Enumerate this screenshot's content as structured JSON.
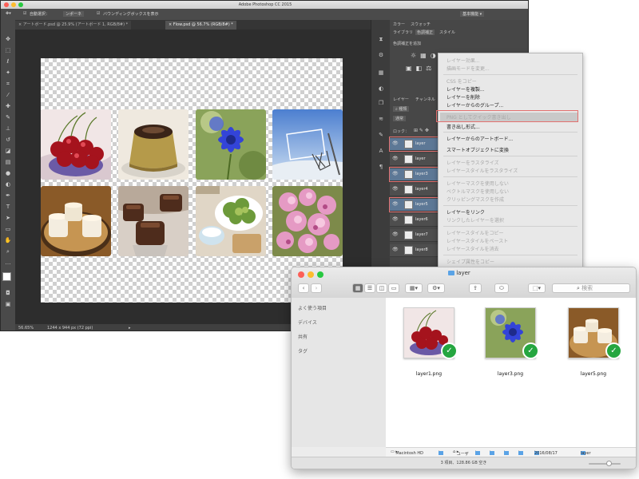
{
  "photoshop": {
    "title": "Adobe Photoshop CC 2015",
    "options": {
      "auto_select": "自動選択：",
      "auto_select_value": "ンポーネ",
      "transform_controls": "バウンディングボックスを表示"
    },
    "tabs": [
      {
        "label": "アートボード.psd @ 25.9% (アートボード 1, RGB/8#) *"
      },
      {
        "label": "Flow.psd @ 56.7% (RGB/8#) *"
      }
    ],
    "status": {
      "zoom": "56.65%",
      "doc_info": "ドキュメント：1.54M/2.57M",
      "size": "1244 x 944 px (72 ppi)"
    },
    "artboard_photos": [
      {
        "name": "cherries-photo"
      },
      {
        "name": "pudding-photo"
      },
      {
        "name": "blue-flower-photo"
      },
      {
        "name": "basketball-hoop-photo"
      },
      {
        "name": "milk-drinks-photo"
      },
      {
        "name": "chocolate-cakes-photo"
      },
      {
        "name": "salad-photo"
      },
      {
        "name": "pink-flowers-photo"
      }
    ],
    "panel_tabs": {
      "top": [
        "カラー",
        "スウォッチ"
      ],
      "second": [
        "ライブラリ",
        "色調補正",
        "スタイル"
      ],
      "adjustments_title": "色調補正を追加",
      "layers_tabs": [
        "レイヤー",
        "チャンネル"
      ],
      "kind": "種類",
      "mode": "通常",
      "lock": "ロック："
    },
    "layers": [
      {
        "name": "layer",
        "selected": true
      },
      {
        "name": "layer",
        "selected": false
      },
      {
        "name": "layer3",
        "selected": true
      },
      {
        "name": "layer4",
        "selected": false
      },
      {
        "name": "layer5",
        "selected": true
      },
      {
        "name": "layer6",
        "selected": false
      },
      {
        "name": "layer7",
        "selected": false
      },
      {
        "name": "layer8",
        "selected": false
      }
    ]
  },
  "context_menu": {
    "items": [
      {
        "label": "レイヤー効果...",
        "enabled": false
      },
      {
        "label": "描画モードを変更...",
        "enabled": false
      },
      {
        "label": "CSS をコピー",
        "enabled": false
      },
      {
        "label": "レイヤーを複製...",
        "enabled": true
      },
      {
        "label": "レイヤーを削除",
        "enabled": true
      },
      {
        "label": "レイヤーからのグループ...",
        "enabled": true
      },
      {
        "label": "PNG としてクイック書き出し",
        "enabled": false,
        "highlight": true
      },
      {
        "label": "書き出し形式...",
        "enabled": true
      },
      {
        "label": "レイヤーからのアートボード...",
        "enabled": true
      },
      {
        "label": "スマートオブジェクトに変換",
        "enabled": true
      },
      {
        "label": "レイヤーをラスタライズ",
        "enabled": false
      },
      {
        "label": "レイヤースタイルをラスタライズ",
        "enabled": false
      },
      {
        "label": "レイヤーマスクを使用しない",
        "enabled": false
      },
      {
        "label": "ベクトルマスクを使用しない",
        "enabled": false
      },
      {
        "label": "クリッピングマスクを作成",
        "enabled": false
      },
      {
        "label": "レイヤーをリンク",
        "enabled": true
      },
      {
        "label": "リンクしたレイヤーを選択",
        "enabled": false
      },
      {
        "label": "レイヤースタイルをコピー",
        "enabled": false
      },
      {
        "label": "レイヤースタイルをペースト",
        "enabled": false
      },
      {
        "label": "レイヤースタイルを消去",
        "enabled": false
      },
      {
        "label": "シェイプ属性をコピー",
        "enabled": false
      }
    ]
  },
  "finder": {
    "title": "layer",
    "search_placeholder": "検索",
    "sidebar": [
      "よく使う項目",
      "デバイス",
      "共有",
      "タグ"
    ],
    "files": [
      {
        "name": "layer1.png",
        "photo": "cherries-photo"
      },
      {
        "name": "layer3.png",
        "photo": "blue-flower-photo"
      },
      {
        "name": "layer5.png",
        "photo": "milk-drinks-photo"
      }
    ],
    "path": [
      "Macintosh HD",
      "ユーザ",
      "",
      "",
      "",
      "2016/08/17",
      "layer"
    ],
    "status": "3 項目、128.86 GB 空き"
  },
  "colors": {
    "ps_bg": "#3a3a3a",
    "selection": "#5d7896",
    "highlight_red": "#e2706f",
    "check_green": "#25a640",
    "folder_blue": "#5aa3e6"
  },
  "icons": [
    "search-icon",
    "gear-icon",
    "share-icon",
    "tag-icon",
    "folder-icon",
    "eye-icon",
    "check-icon",
    "back-icon",
    "forward-icon",
    "icon-view-icon",
    "list-view-icon",
    "column-view-icon",
    "gallery-view-icon",
    "arrange-icon"
  ]
}
